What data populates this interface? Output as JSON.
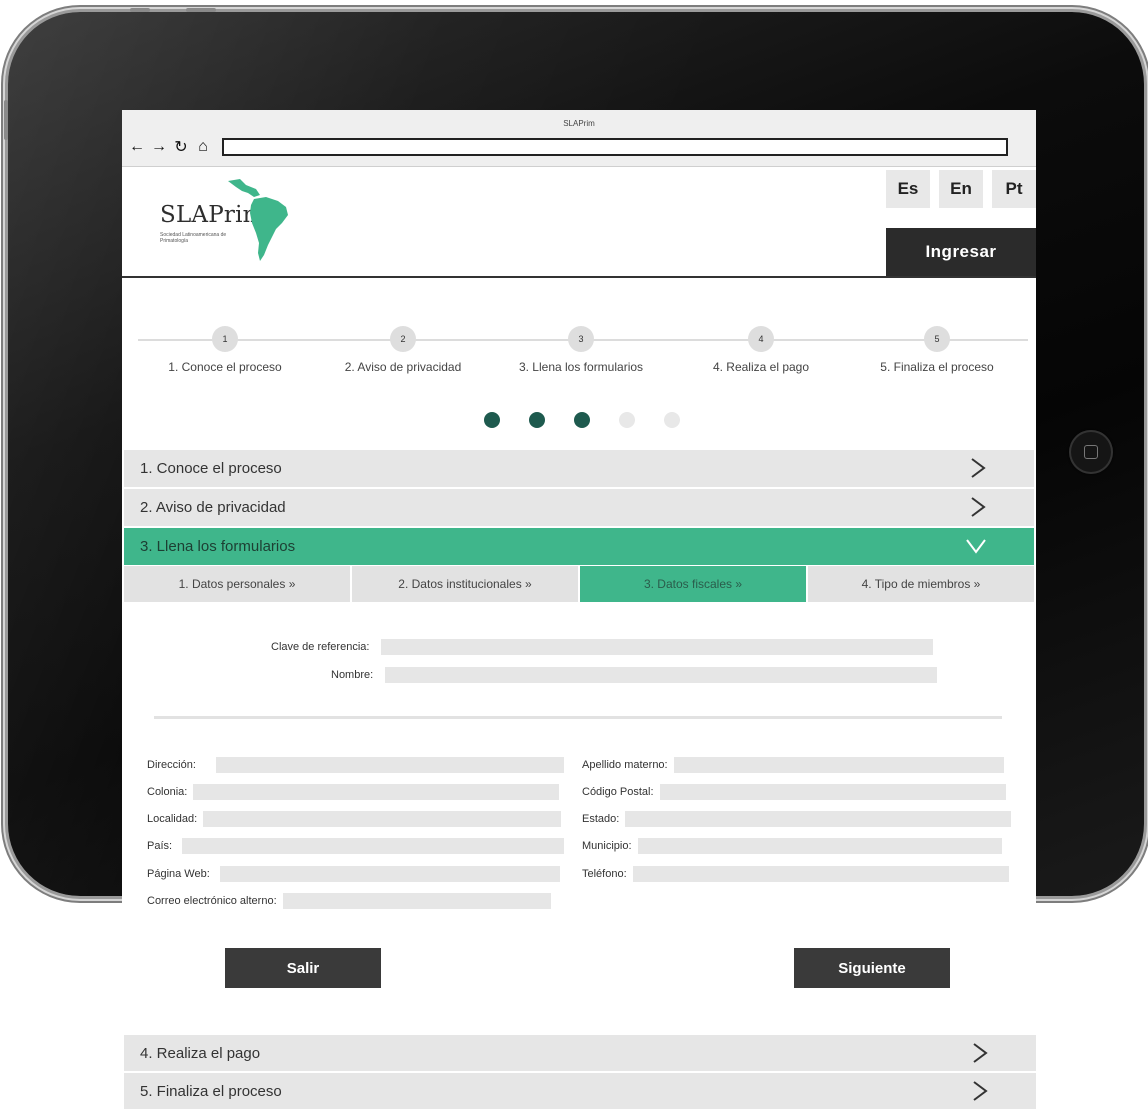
{
  "window": {
    "title": "SLAPrim",
    "address": ""
  },
  "nav": {
    "back": "←",
    "forward": "→",
    "reload": "↻",
    "home": "⌂"
  },
  "brand": {
    "name": "SLAPrim",
    "subtitle": "Sociedad Latinoamericana de Primatología"
  },
  "languages": [
    "Es",
    "En",
    "Pt"
  ],
  "login_label": "Ingresar",
  "steps": [
    {
      "number": "1",
      "label": "1. Conoce el proceso"
    },
    {
      "number": "2",
      "label": "2. Aviso de privacidad"
    },
    {
      "number": "3",
      "label": "3. Llena los formularios"
    },
    {
      "number": "4",
      "label": "4. Realiza el pago"
    },
    {
      "number": "5",
      "label": "5. Finaliza el proceso"
    }
  ],
  "progress": {
    "completed": 3,
    "total": 5
  },
  "accordion": [
    {
      "label": "1. Conoce el proceso",
      "state": "collapsed"
    },
    {
      "label": "2. Aviso de privacidad",
      "state": "collapsed"
    },
    {
      "label": "3. Llena los formularios",
      "state": "expanded"
    },
    {
      "label": "4. Realiza el pago",
      "state": "collapsed"
    },
    {
      "label": "5. Finaliza el proceso",
      "state": "collapsed"
    }
  ],
  "subtabs": [
    {
      "label": "1. Datos personales »",
      "active": false
    },
    {
      "label": "2. Datos institucionales »",
      "active": false
    },
    {
      "label": "3. Datos fiscales »",
      "active": true
    },
    {
      "label": "4. Tipo de miembros »",
      "active": false
    }
  ],
  "form": {
    "top": {
      "reference_key": {
        "label": "Clave de referencia:",
        "value": ""
      },
      "name": {
        "label": "Nombre:",
        "value": ""
      }
    },
    "left": {
      "address": {
        "label": "Dirección:",
        "value": ""
      },
      "colony": {
        "label": "Colonia:",
        "value": ""
      },
      "locality": {
        "label": "Localidad:",
        "value": ""
      },
      "country": {
        "label": "País:",
        "value": ""
      },
      "website": {
        "label": "Página Web:",
        "value": ""
      },
      "alt_email": {
        "label": "Correo electrónico alterno:",
        "value": ""
      }
    },
    "right": {
      "mother_surname": {
        "label": "Apellido materno:",
        "value": ""
      },
      "postal_code": {
        "label": "Código Postal:",
        "value": ""
      },
      "state": {
        "label": "Estado:",
        "value": ""
      },
      "municipality": {
        "label": "Municipio:",
        "value": ""
      },
      "phone": {
        "label": "Teléfono:",
        "value": ""
      }
    }
  },
  "buttons": {
    "exit": "Salir",
    "next": "Siguiente"
  },
  "colors": {
    "accent": "#3fb68b",
    "dark": "#2b2b2b",
    "dot_active": "#1e5a4e",
    "bar": "#e6e6e6"
  }
}
